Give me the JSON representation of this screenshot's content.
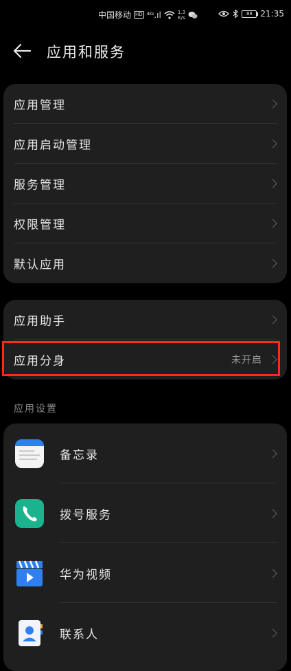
{
  "status_bar": {
    "carrier": "中国移动",
    "hd": "HD",
    "signal": "⁴ᴳ.ıl",
    "speed_value": "1.3",
    "speed_unit": "K/s",
    "battery": "88",
    "time": "21:35"
  },
  "header": {
    "title": "应用和服务"
  },
  "group1": {
    "items": [
      {
        "label": "应用管理"
      },
      {
        "label": "应用启动管理"
      },
      {
        "label": "服务管理"
      },
      {
        "label": "权限管理"
      },
      {
        "label": "默认应用"
      }
    ]
  },
  "group2": {
    "items": [
      {
        "label": "应用助手"
      },
      {
        "label": "应用分身",
        "status": "未开启"
      }
    ]
  },
  "app_settings": {
    "section_title": "应用设置",
    "apps": [
      {
        "label": "备忘录",
        "icon": "notes-icon"
      },
      {
        "label": "拨号服务",
        "icon": "phone-icon"
      },
      {
        "label": "华为视频",
        "icon": "video-icon"
      },
      {
        "label": "联系人",
        "icon": "contacts-icon"
      }
    ]
  },
  "colors": {
    "background": "#000000",
    "card": "#1f1f1f",
    "highlight": "#ff2a1b"
  }
}
